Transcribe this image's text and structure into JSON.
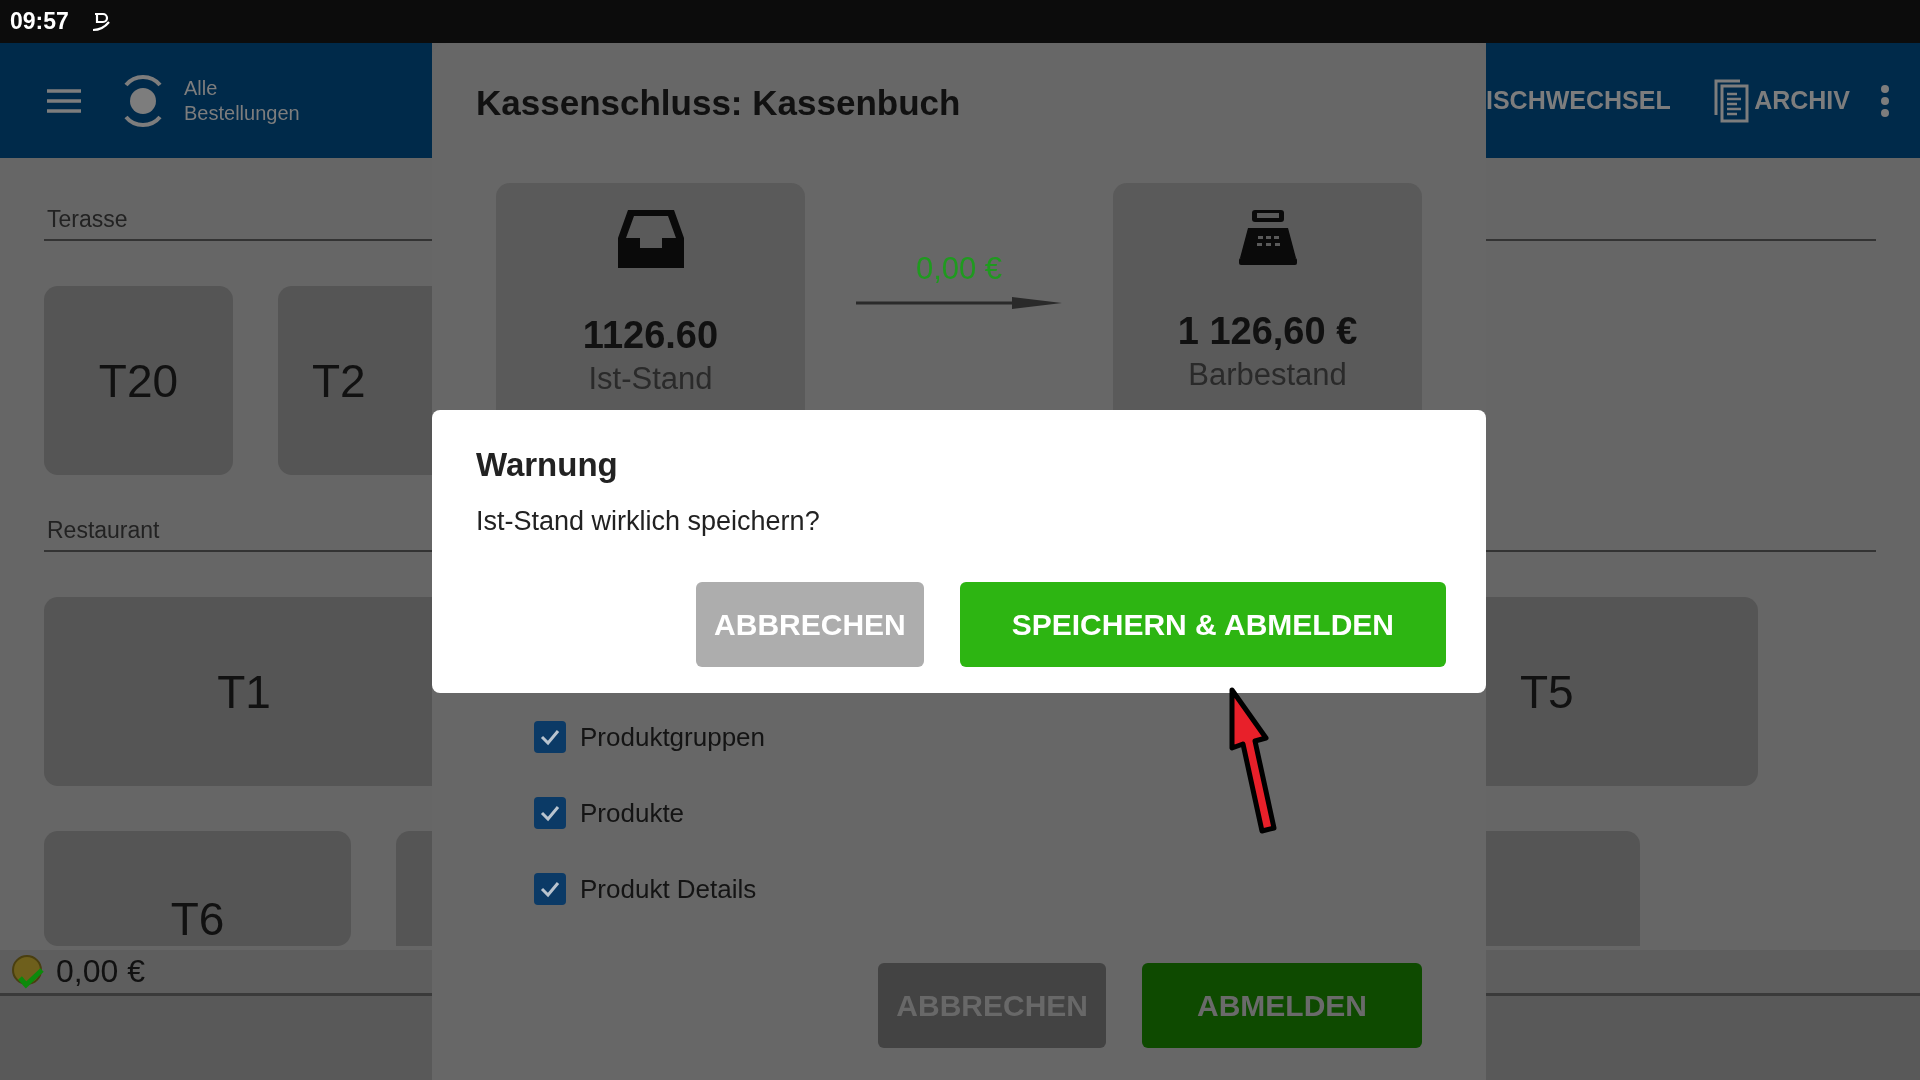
{
  "status_bar": {
    "time": "09:57"
  },
  "app_bar": {
    "logo_label": "Alle Bestellungen",
    "actions": [
      {
        "kind": "text",
        "label": "ISCHWECHSEL"
      },
      {
        "kind": "archive",
        "label": "ARCHIV"
      }
    ]
  },
  "floor": {
    "sections": [
      {
        "title": "Terasse",
        "tables": [
          "T20",
          "T2"
        ]
      },
      {
        "title": "Restaurant",
        "tables": [
          "T1",
          "T6"
        ]
      }
    ],
    "right_tables": [
      "T5"
    ],
    "balance": "0,00 €"
  },
  "dialog": {
    "title": "Kassenschluss: Kassenbuch",
    "from": {
      "amount": "1126.60",
      "label": "Ist-Stand"
    },
    "difference": "0,00 €",
    "to": {
      "amount": "1 126,60 €",
      "label": "Barbestand"
    },
    "options": [
      {
        "label": "Produktgruppen",
        "checked": true
      },
      {
        "label": "Produkte",
        "checked": true
      },
      {
        "label": "Produkt Details",
        "checked": true
      }
    ],
    "buttons": [
      {
        "kind": "secondary",
        "label": "ABBRECHEN"
      },
      {
        "kind": "primary",
        "label": "ABMELDEN"
      }
    ]
  },
  "warning": {
    "title": "Warnung",
    "message": "Ist-Stand wirklich speichern?",
    "buttons": [
      {
        "kind": "secondary",
        "label": "ABBRECHEN"
      },
      {
        "kind": "primary",
        "label": "SPEICHERN & ABMELDEN"
      }
    ]
  }
}
